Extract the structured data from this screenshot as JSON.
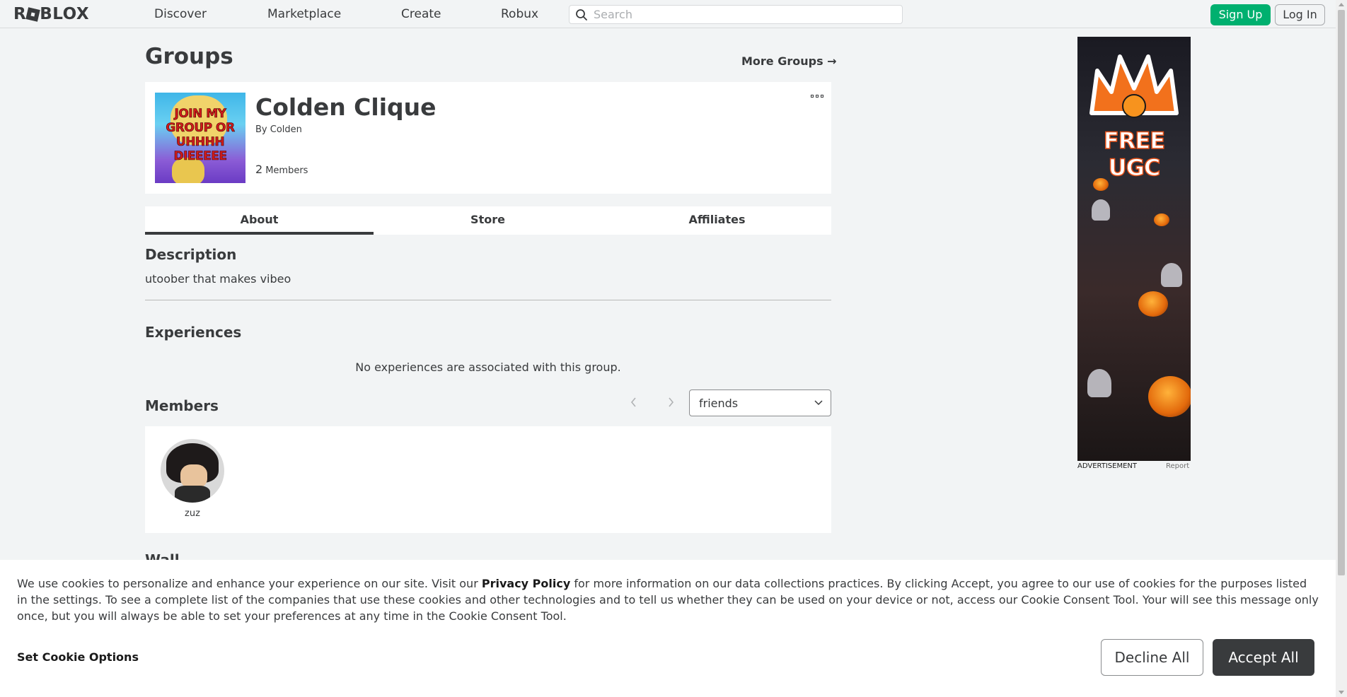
{
  "nav": {
    "logo": "ROBLOX",
    "links": [
      "Discover",
      "Marketplace",
      "Create",
      "Robux"
    ],
    "search_placeholder": "Search",
    "signup_label": "Sign Up",
    "login_label": "Log In"
  },
  "page": {
    "title": "Groups",
    "more_groups": "More Groups →"
  },
  "group": {
    "name": "Colden Clique",
    "by_label": "By",
    "owner": "Colden",
    "members_count": "2",
    "members_label": "Members",
    "emblem_text": "JOIN MY GROUP OR UHHHH DIEEEEE"
  },
  "tabs": [
    "About",
    "Store",
    "Affiliates"
  ],
  "description": {
    "heading": "Description",
    "text": "utoober that makes vibeo"
  },
  "experiences": {
    "heading": "Experiences",
    "empty": "No experiences are associated with this group."
  },
  "members": {
    "heading": "Members",
    "filter_value": "friends",
    "list": [
      {
        "name": "zuz"
      }
    ]
  },
  "wall": {
    "heading": "Wall"
  },
  "ad": {
    "headline": "FREE UGC",
    "caption": "ADVERTISEMENT",
    "report": "Report"
  },
  "cookie": {
    "text_before": "We use cookies to personalize and enhance your experience on our site. Visit our ",
    "privacy_link": "Privacy Policy",
    "text_after": " for more information on our data collections practices. By clicking Accept, you agree to our use of cookies for the purposes listed in the settings. To see a complete list of the companies that use these cookies and other technologies and to tell us whether they can be used on your device or not, access our Cookie Consent Tool. Your will see this message only once, but you will always be able to set your preferences at any time in the Cookie Consent Tool.",
    "options_label": "Set Cookie Options",
    "decline_label": "Decline All",
    "accept_label": "Accept All"
  },
  "colors": {
    "signup": "#00b06f",
    "accept": "#393b3d",
    "background": "#f2f4f5"
  }
}
